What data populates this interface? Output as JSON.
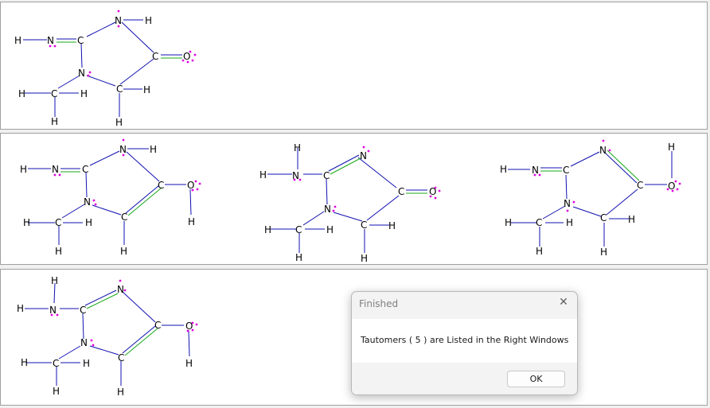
{
  "panels": [
    {
      "name": "top",
      "tautomers": 1
    },
    {
      "name": "middle",
      "tautomers": 3
    },
    {
      "name": "bottom",
      "tautomers": 1
    }
  ],
  "atom_labels": {
    "hydrogen": "H",
    "nitrogen": "N",
    "carbon": "C",
    "oxygen": "O"
  },
  "colors": {
    "single_bond": "#1010b0",
    "double_bond": "#18a818",
    "lone_pair": "#e000e0",
    "panel_background": "#ffffff",
    "window_background": "#f0f0f0"
  },
  "dialog": {
    "title": "Finished",
    "close_icon": "close-icon",
    "message": "Tautomers ( 5 ) are Listed in the Right Windows",
    "ok_label": "OK"
  }
}
